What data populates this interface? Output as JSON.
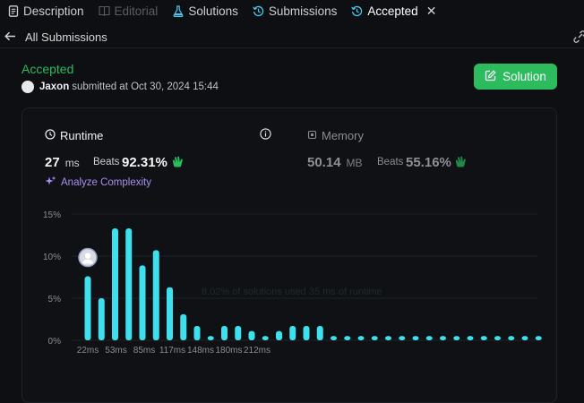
{
  "tabs": [
    {
      "label": "Description",
      "state": "normal"
    },
    {
      "label": "Editorial",
      "state": "disabled"
    },
    {
      "label": "Solutions",
      "state": "normal"
    },
    {
      "label": "Submissions",
      "state": "normal"
    },
    {
      "label": "Accepted",
      "state": "active"
    }
  ],
  "subnav": {
    "back_label": "All Submissions"
  },
  "submission": {
    "status": "Accepted",
    "user": "Jaxon",
    "submitted_text": "submitted at Oct 30, 2024 15:44",
    "solution_button": "Solution"
  },
  "runtime": {
    "label": "Runtime",
    "value": "27",
    "unit": "ms",
    "beats_label": "Beats",
    "beats_value": "92.31%"
  },
  "memory": {
    "label": "Memory",
    "value": "50.14",
    "unit": "MB",
    "beats_label": "Beats",
    "beats_value": "55.16%"
  },
  "analyze_label": "Analyze Complexity",
  "watermark": "8.02% of solutions used 35 ms of runtime",
  "colors": {
    "accent_green": "#2cbb5d",
    "bar_cyan": "#3ee0ee",
    "analyze_purple": "#a98ff5"
  },
  "chart_data": {
    "type": "bar",
    "x_tick_labels": [
      "22ms",
      "53ms",
      "85ms",
      "117ms",
      "148ms",
      "180ms",
      "212ms"
    ],
    "y_tick_labels": [
      "0%",
      "5%",
      "10%",
      "15%"
    ],
    "ylim": [
      0,
      15
    ],
    "grid": true,
    "values": [
      7.6,
      5.0,
      13.3,
      13.3,
      8.9,
      10.7,
      6.3,
      3.1,
      1.7,
      0.5,
      1.7,
      1.7,
      1.1,
      0.5,
      1.1,
      1.7,
      1.7,
      1.7,
      0.5,
      0.5,
      0.5,
      0.5,
      0.5,
      0.5,
      0.5,
      0.5,
      0.5,
      0.5,
      0.5,
      0.5,
      0.5,
      0.5,
      0.5,
      0.5
    ],
    "highlight_index": 0
  }
}
